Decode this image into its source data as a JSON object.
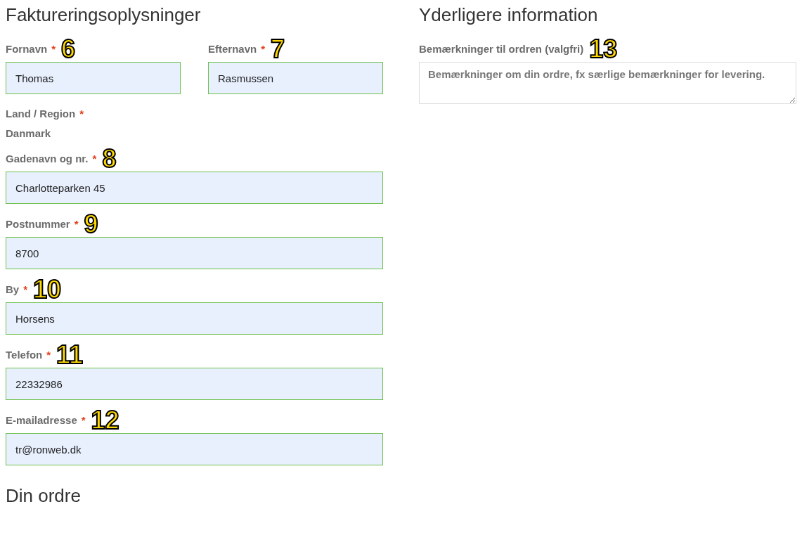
{
  "billing": {
    "heading": "Faktureringsoplysninger",
    "name_row": [
      {
        "label": "Fornavn",
        "required": "*",
        "marker": "6",
        "value": "Thomas"
      },
      {
        "label": "Efternavn",
        "required": "*",
        "marker": "7",
        "value": "Rasmussen"
      }
    ],
    "country": {
      "label": "Land / Region",
      "required": "*",
      "value": "Danmark"
    },
    "fields": [
      {
        "label": "Gadenavn og nr.",
        "required": "*",
        "marker": "8",
        "value": "Charlotteparken 45"
      },
      {
        "label": "Postnummer",
        "required": "*",
        "marker": "9",
        "value": "8700"
      },
      {
        "label": "By",
        "required": "*",
        "marker": "10",
        "value": "Horsens"
      },
      {
        "label": "Telefon",
        "required": "*",
        "marker": "11",
        "value": "22332986"
      },
      {
        "label": "E-mailadresse",
        "required": "*",
        "marker": "12",
        "value": "tr@ronweb.dk"
      }
    ]
  },
  "order_heading": "Din ordre",
  "additional": {
    "heading": "Yderligere information",
    "label": "Bemærkninger til ordren (valgfri)",
    "marker": "13",
    "placeholder": "Bemærkninger om din ordre, fx særlige bemærkninger for levering."
  }
}
